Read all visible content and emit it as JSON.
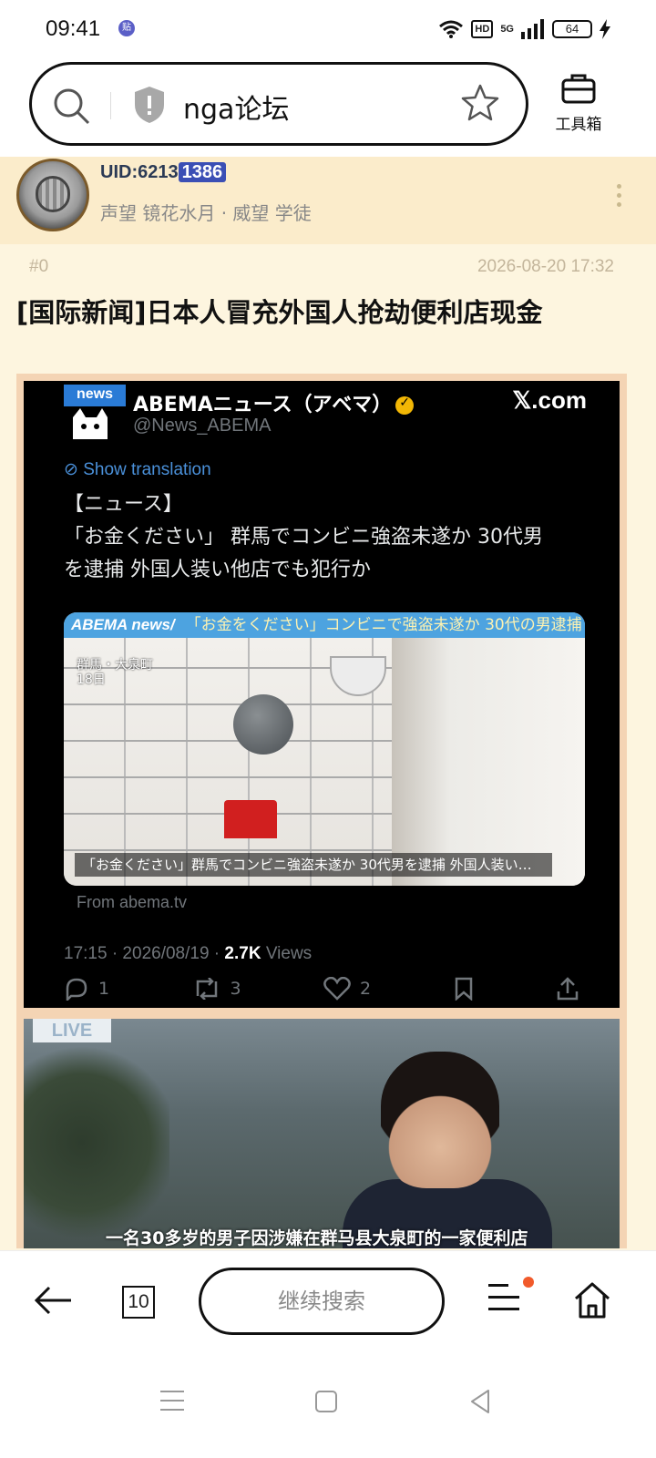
{
  "status_bar": {
    "time": "09:41",
    "app_badge": "贴",
    "network": "5G",
    "hd": "HD",
    "battery": "64"
  },
  "header": {
    "search_text": "nga论坛",
    "toolbox_label": "工具箱"
  },
  "post": {
    "uid_prefix": "UID:6213",
    "uid_highlight": "1386",
    "user_meta": "声望 镜花水月 · 威望 学徒",
    "floor": "#0",
    "timestamp": "2026-08-20 17:32",
    "title": "[国际新闻]日本人冒充外国人抢劫便利店现金"
  },
  "tweet": {
    "news_badge": "news",
    "name": "ABEMAニュース（アベマ）",
    "handle": "@News_ABEMA",
    "platform": "𝕏.com",
    "show_translation": "Show translation",
    "text_line1": "【ニュース】",
    "text_line2": "「お金ください」 群馬でコンビニ強盗未遂か 30代男",
    "text_line3": "を逮捕 外国人装い他店でも犯行か",
    "card_brand": "ABEMA news/",
    "card_headline": "「お金をください」コンビニで強盗未遂か 30代の男逮捕",
    "card_location": "群馬・大泉町",
    "card_date": "18日",
    "card_subtitle": "「お金ください」群馬でコンビニ強盗未遂か 30代男を逮捕 外国人装い…",
    "card_from": "From abema.tv",
    "time": "17:15 · 2026/08/19 · ",
    "views_count": "2.7K",
    "views_label": " Views",
    "replies": "1",
    "retweets": "3",
    "likes": "2"
  },
  "video": {
    "live_badge": "LIVE",
    "subtitle": "一名30多岁的男子因涉嫌在群马县大泉町的一家便利店"
  },
  "bottom_nav": {
    "tab_count": "10",
    "continue_search": "继续搜索"
  },
  "colors": {
    "content_bg": "#fdf5df",
    "user_row_bg": "#fbeccb",
    "uid_highlight": "#3b4fb5",
    "notification_dot": "#f15a2b",
    "tweet_link": "#4a90d9"
  }
}
